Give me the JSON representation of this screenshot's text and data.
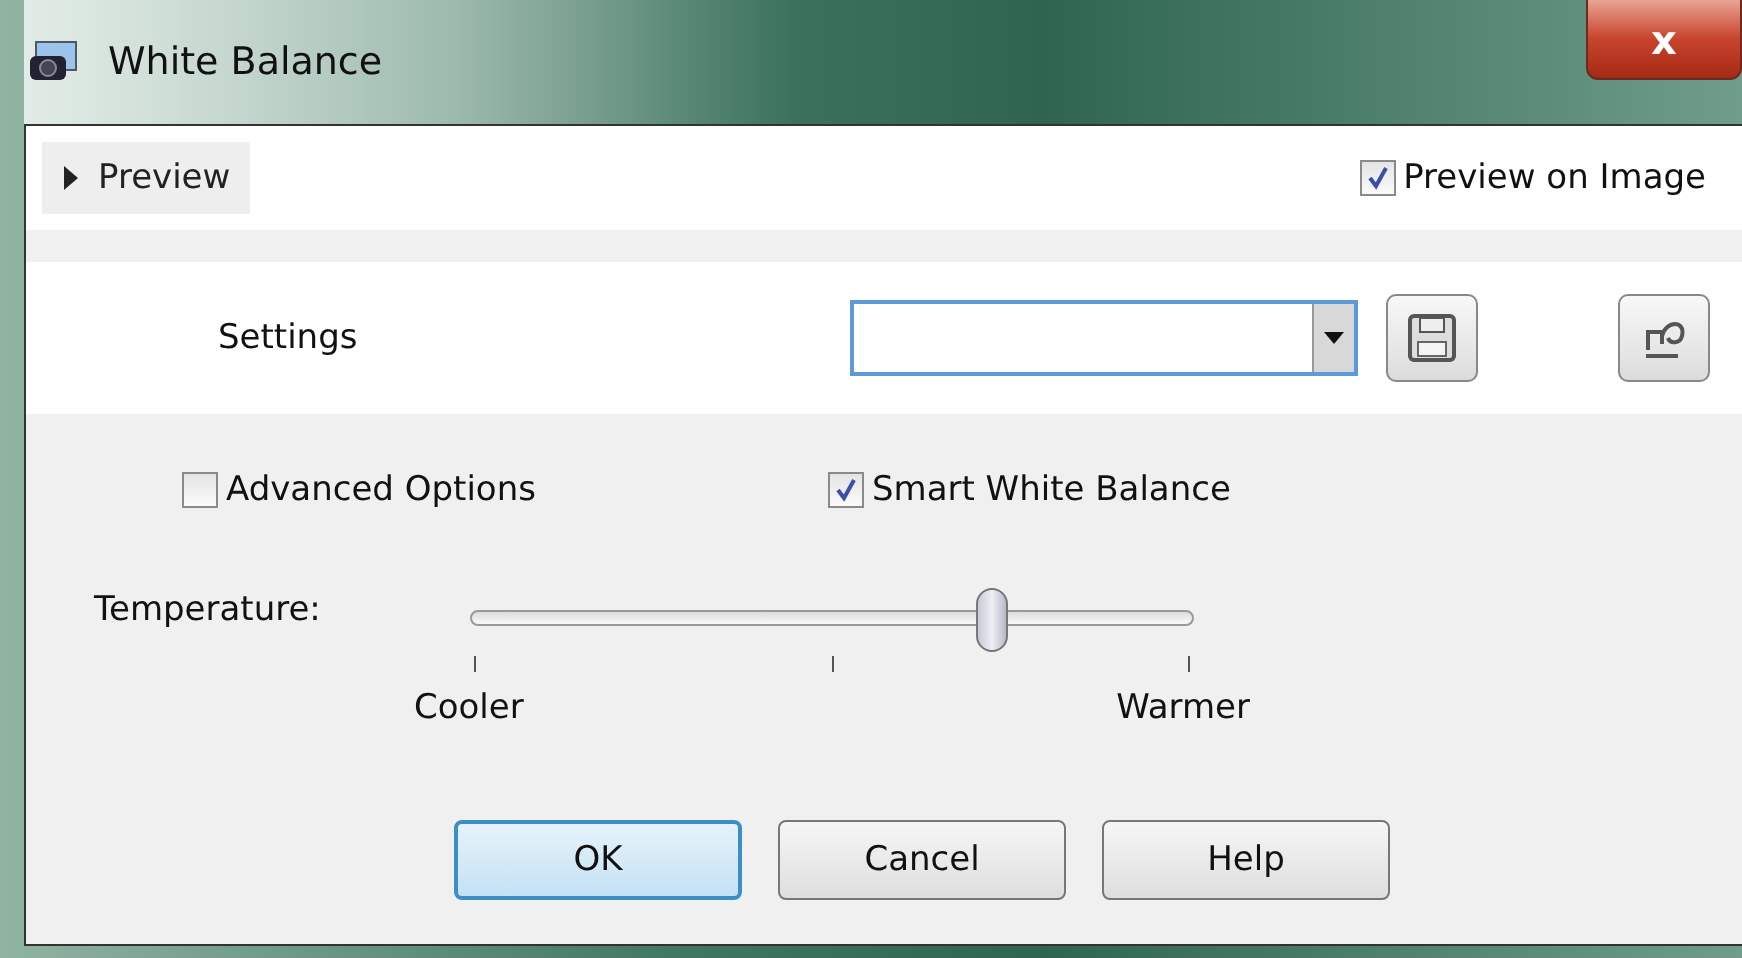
{
  "window": {
    "title": "White Balance",
    "close": "x"
  },
  "preview": {
    "label": "Preview",
    "expanded": false
  },
  "preview_on_image": {
    "label": "Preview on Image",
    "checked": true
  },
  "settings": {
    "label": "Settings"
  },
  "options": [
    {
      "label": "Advanced Options",
      "checked": false
    },
    {
      "label": "Smart White Balance",
      "checked": true
    }
  ],
  "temperature": {
    "label": "Temperature:",
    "level": 0.72,
    "min_label": "Cooler",
    "max_label": "Warmer"
  },
  "buttons": [
    {
      "label": "OK",
      "default": true
    },
    {
      "label": "Cancel",
      "default": false
    },
    {
      "label": "Help",
      "default": false
    }
  ]
}
